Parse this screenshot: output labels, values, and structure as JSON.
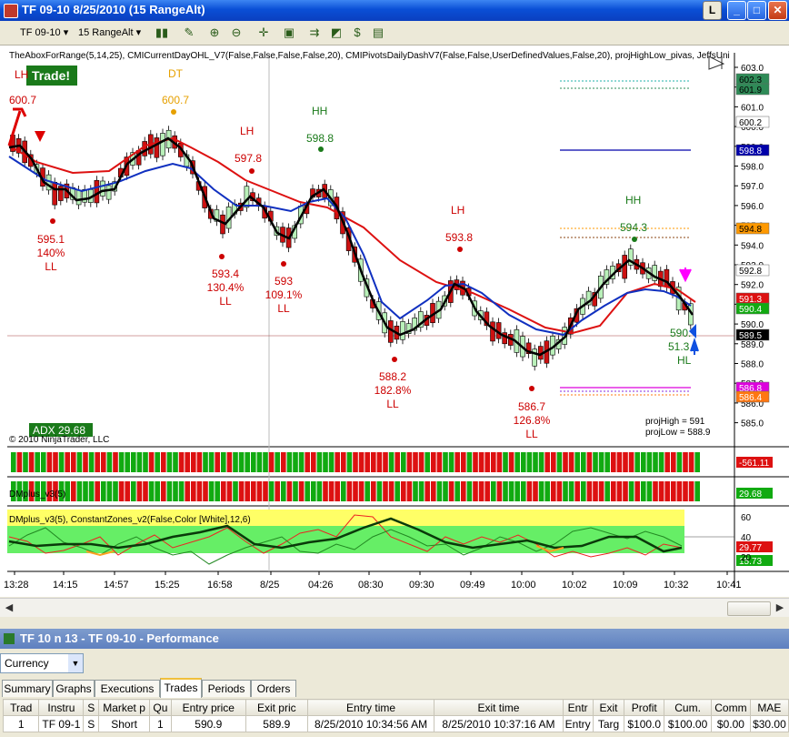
{
  "window": {
    "title": "TF 09-10  8/25/2010 (15 RangeAlt)"
  },
  "toolbar": {
    "instrument": "TF 09-10",
    "period": "15 RangeAlt"
  },
  "chart": {
    "indicator_line": "TheAboxForRange(5,14,25), CMICurrentDayOHL_V7(False,False,False,False,20), CMIPivotsDailyDashV7(False,False,UserDefinedValues,False,20), projHighLow_pivas, JeffsUni",
    "trade_badge": "Trade!",
    "copyright": "© 2010 NinjaTrader, LLC",
    "adx_badge": "ADX 29.68",
    "proj_high": "projHigh = 591",
    "proj_low": "projLow = 588.9",
    "dmplus_label": "DMplus_v3(5)",
    "panel3_label": "DMplus_v3(5), ConstantZones_v2(False,Color [White],12,6)",
    "annotations": {
      "lh1": "LH",
      "dt": "DT",
      "lh2": "LH",
      "hh1": "HH",
      "lh3": "LH",
      "hh2": "HH",
      "p6007a": "600.7",
      "p6007b": "600.7",
      "p5978": "597.8",
      "p5988": "598.8",
      "p5938": "593.8",
      "p5943": "594.3",
      "ll1a": "595.1",
      "ll1b": "140%",
      "ll1c": "LL",
      "ll2a": "593.4",
      "ll2b": "130.4%",
      "ll2c": "LL",
      "ll3a": "593",
      "ll3b": "109.1%",
      "ll3c": "LL",
      "ll4a": "588.2",
      "ll4b": "182.8%",
      "ll4c": "LL",
      "ll5a": "586.7",
      "ll5b": "126.8%",
      "ll5c": "LL",
      "hl1": "590.",
      "hl2": "51.3",
      "hl3": "HL"
    },
    "price_axis": [
      "603.0",
      "602.0",
      "601.0",
      "600.0",
      "599.0",
      "598.0",
      "597.0",
      "596.0",
      "595.0",
      "594.0",
      "593.0",
      "592.0",
      "591.0",
      "590.0",
      "589.0",
      "588.0",
      "587.0",
      "586.0",
      "585.0"
    ],
    "price_tags": [
      {
        "label": "602.3",
        "color": "#2e8b57",
        "fg": "#000"
      },
      {
        "label": "601.9",
        "color": "#2e8b57",
        "fg": "#000"
      },
      {
        "label": "600.2",
        "color": "#ffffff",
        "fg": "#000"
      },
      {
        "label": "598.8",
        "color": "#0000aa",
        "fg": "#fff"
      },
      {
        "label": "594.8",
        "color": "#ff9900",
        "fg": "#000"
      },
      {
        "label": "592.8",
        "color": "#ffffff",
        "fg": "#000"
      },
      {
        "label": "591.3",
        "color": "#dd1111",
        "fg": "#fff"
      },
      {
        "label": "590.4",
        "color": "#11aa11",
        "fg": "#fff"
      },
      {
        "label": "589.5",
        "color": "#000000",
        "fg": "#fff"
      },
      {
        "label": "586.8",
        "color": "#dd00dd",
        "fg": "#fff"
      },
      {
        "label": "586.4",
        "color": "#ff7711",
        "fg": "#fff"
      }
    ],
    "panel_tags": [
      {
        "label": "-561.11",
        "color": "#dd1111",
        "fg": "#fff"
      },
      {
        "label": "29.68",
        "color": "#11aa11",
        "fg": "#fff"
      },
      {
        "label": "29.77",
        "color": "#dd1111",
        "fg": "#fff"
      },
      {
        "label": "15.73",
        "color": "#11aa11",
        "fg": "#fff"
      }
    ],
    "osc_axis": [
      "60",
      "40",
      "20"
    ],
    "time_axis": [
      "13:28",
      "14:15",
      "14:57",
      "15:25",
      "16:58",
      "8/25",
      "04:26",
      "08:30",
      "09:30",
      "09:49",
      "10:00",
      "10:02",
      "10:09",
      "10:32",
      "10:41"
    ]
  },
  "performance": {
    "title": "TF 10 n 13 - TF 09-10 - Performance",
    "currency": "Currency",
    "tabs": [
      "Summary",
      "Graphs",
      "Executions",
      "Trades",
      "Periods",
      "Orders"
    ],
    "active_tab": "Trades",
    "columns": [
      "Trad",
      "Instru",
      "S",
      "Market p",
      "Qu",
      "Entry price",
      "Exit pric",
      "Entry time",
      "Exit time",
      "Entr",
      "Exit",
      "Profit",
      "Cum.",
      "Comm",
      "MAE"
    ],
    "rows": [
      [
        "1",
        "TF 09-1",
        "S",
        "Short",
        "1",
        "590.9",
        "589.9",
        "8/25/2010 10:34:56 AM",
        "8/25/2010 10:37:16 AM",
        "Entry",
        "Targ",
        "$100.0",
        "$100.00",
        "$0.00",
        "$30.00"
      ]
    ]
  }
}
